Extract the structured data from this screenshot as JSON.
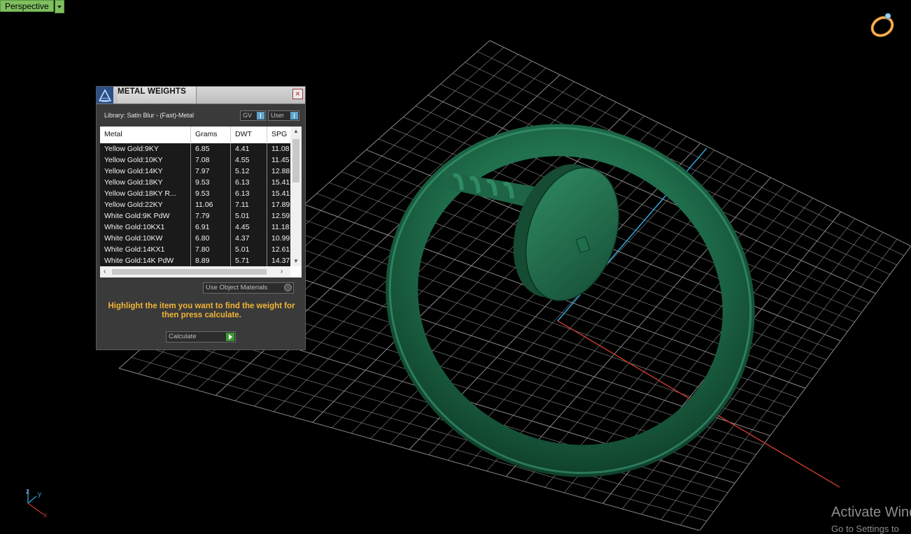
{
  "viewport": {
    "view_name": "Perspective",
    "grid_color": "#8a8a8a",
    "model_color": "#1e6b4a",
    "axis_colors": {
      "x": "#c0392b",
      "y": "#2fa8d8"
    },
    "gizmo": {
      "z": "z",
      "y": "y",
      "x": "x"
    }
  },
  "watermark": {
    "line1": "Activate Wind",
    "line2": "Go to Settings to"
  },
  "panel": {
    "title": "METAL WEIGHTS",
    "library_label": "Library: Satin Blur - (Fast)-Metal",
    "toggles": {
      "gv": "GV",
      "user": "User"
    },
    "columns": [
      "Metal",
      "Grams",
      "DWT",
      "SPG"
    ],
    "rows": [
      [
        "Yellow Gold:9KY",
        "6.85",
        "4.41",
        "11.08"
      ],
      [
        "Yellow Gold:10KY",
        "7.08",
        "4.55",
        "11.45"
      ],
      [
        "Yellow Gold:14KY",
        "7.97",
        "5.12",
        "12.88"
      ],
      [
        "Yellow Gold:18KY",
        "9.53",
        "6.13",
        "15.41"
      ],
      [
        "Yellow Gold:18KY R...",
        "9.53",
        "6.13",
        "15.41"
      ],
      [
        "Yellow Gold:22KY",
        "11.06",
        "7.11",
        "17.89"
      ],
      [
        "White Gold:9K PdW",
        "7.79",
        "5.01",
        "12.59"
      ],
      [
        "White Gold:10KX1",
        "6.91",
        "4.45",
        "11.18"
      ],
      [
        "White Gold:10KW",
        "6.80",
        "4.37",
        "10.99"
      ],
      [
        "White Gold:14KX1",
        "7.80",
        "5.01",
        "12.61"
      ],
      [
        "White Gold:14K PdW",
        "8.89",
        "5.71",
        "14.37"
      ]
    ],
    "use_object_materials": "Use Object Materials",
    "hint": "Highlight the item you want to find the weight for then press calculate.",
    "calculate": "Calculate"
  }
}
